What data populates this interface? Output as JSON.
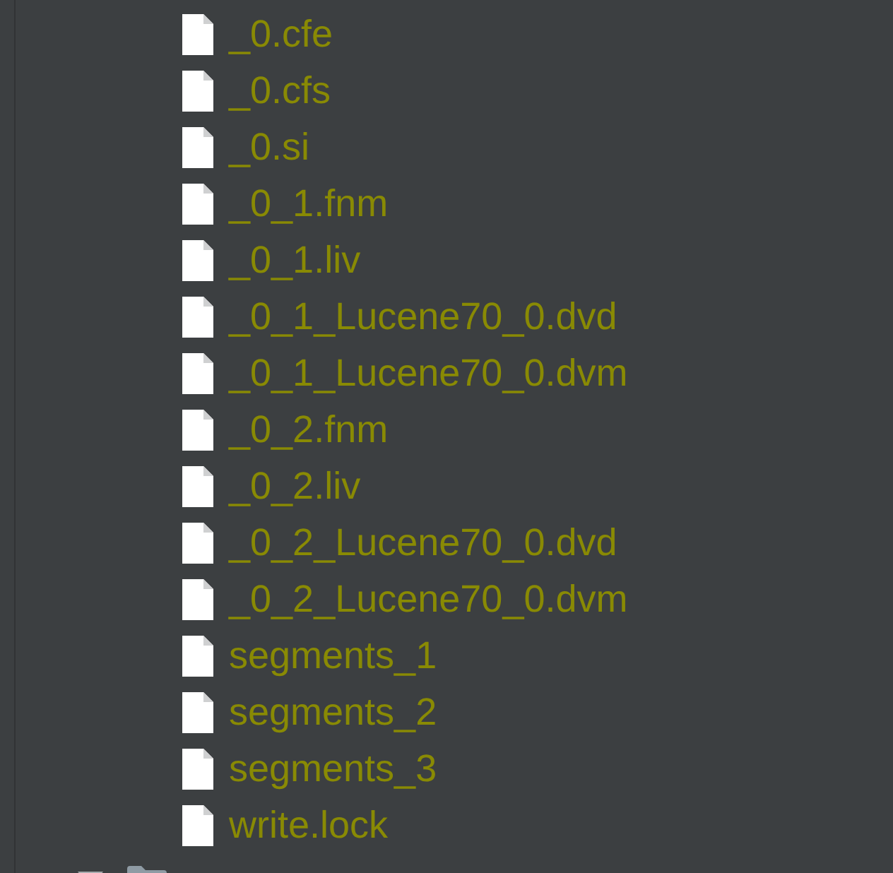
{
  "tree": {
    "items": [
      {
        "children": [
          {
            "kind": "file",
            "label": "_0.cfe"
          },
          {
            "kind": "file",
            "label": "_0.cfs"
          },
          {
            "kind": "file",
            "label": "_0.si"
          },
          {
            "kind": "file",
            "label": "_0_1.fnm"
          },
          {
            "kind": "file",
            "label": "_0_1.liv"
          },
          {
            "kind": "file",
            "label": "_0_1_Lucene70_0.dvd"
          },
          {
            "kind": "file",
            "label": "_0_1_Lucene70_0.dvm"
          },
          {
            "kind": "file",
            "label": "_0_2.fnm"
          },
          {
            "kind": "file",
            "label": "_0_2.liv"
          },
          {
            "kind": "file",
            "label": "_0_2_Lucene70_0.dvd"
          },
          {
            "kind": "file",
            "label": "_0_2_Lucene70_0.dvm"
          },
          {
            "kind": "file",
            "label": "segments_1"
          },
          {
            "kind": "file",
            "label": "segments_2"
          },
          {
            "kind": "file",
            "label": "segments_3"
          },
          {
            "kind": "file",
            "label": "write.lock"
          }
        ]
      },
      {
        "kind": "folder",
        "expanded": true
      }
    ]
  }
}
